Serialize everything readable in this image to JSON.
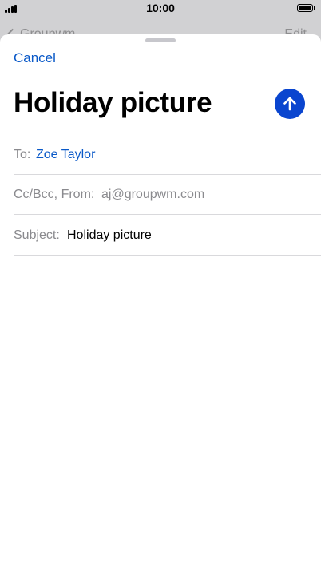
{
  "status_bar": {
    "time": "10:00"
  },
  "background": {
    "back_label": "Groupwm",
    "edit_label": "Edit"
  },
  "compose": {
    "cancel_label": "Cancel",
    "title": "Holiday picture",
    "send_icon": "arrow-up-icon",
    "accent_color": "#0a45cf",
    "fields": {
      "to": {
        "label": "To:",
        "value": "Zoe Taylor"
      },
      "cc_from": {
        "label": "Cc/Bcc, From:",
        "value": "aj@groupwm.com"
      },
      "subject": {
        "label": "Subject:",
        "value": "Holiday picture"
      }
    }
  }
}
